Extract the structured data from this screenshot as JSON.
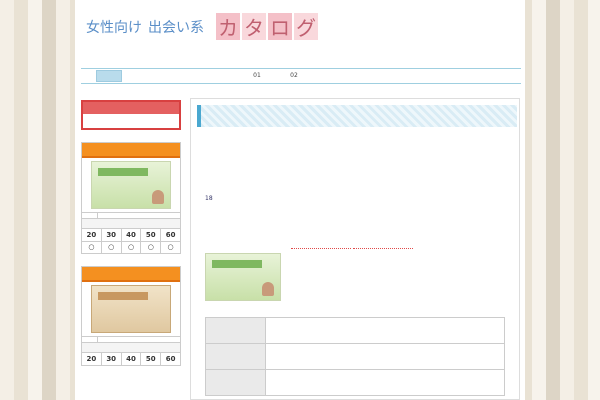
{
  "header": {
    "top_text": "",
    "logo": {
      "part1": "女性向け",
      "part2": "出会い系",
      "part3": "カタログ",
      "colors": {
        "blue": "#5b8fc8",
        "pink_box": "#f4c0c8",
        "pink_text": "#c06070"
      }
    },
    "description": ""
  },
  "nav": {
    "items": [
      {
        "label": "",
        "active": true
      },
      {
        "label": ""
      },
      {
        "label": ""
      },
      {
        "label": ""
      },
      {
        "label": "",
        "suffix": "01"
      },
      {
        "label": "",
        "suffix": "02"
      }
    ],
    "accent": "#b9dcec"
  },
  "breadcrumb": "",
  "sidebar": {
    "special": {
      "title": "",
      "link": ""
    },
    "sites": [
      {
        "title": "",
        "meta1": "",
        "meta2": "",
        "label": "",
        "age_header": "",
        "ages": [
          "20",
          "30",
          "40",
          "50",
          "60"
        ],
        "marks": [
          "○",
          "○",
          "○",
          "○",
          "○"
        ]
      },
      {
        "title": "",
        "meta1": "",
        "meta2": "",
        "label": "",
        "age_header": "",
        "ages": [
          "20",
          "30",
          "40",
          "50",
          "60"
        ],
        "marks": [
          "",
          "",
          "",
          "",
          ""
        ]
      }
    ]
  },
  "main": {
    "heading": "",
    "intro": [
      "",
      "",
      ""
    ],
    "note": {
      "before": "",
      "number": "18",
      "after": ""
    },
    "featured": {
      "title": "",
      "text_a": "",
      "highlight1": "",
      "text_b": "",
      "highlight2": "",
      "text_c": ""
    },
    "table": [
      {
        "key": "",
        "value1": "",
        "value2": ""
      },
      {
        "key": "",
        "value1": "",
        "value2": ""
      },
      {
        "key": "",
        "value1": "",
        "value2": ""
      }
    ]
  }
}
